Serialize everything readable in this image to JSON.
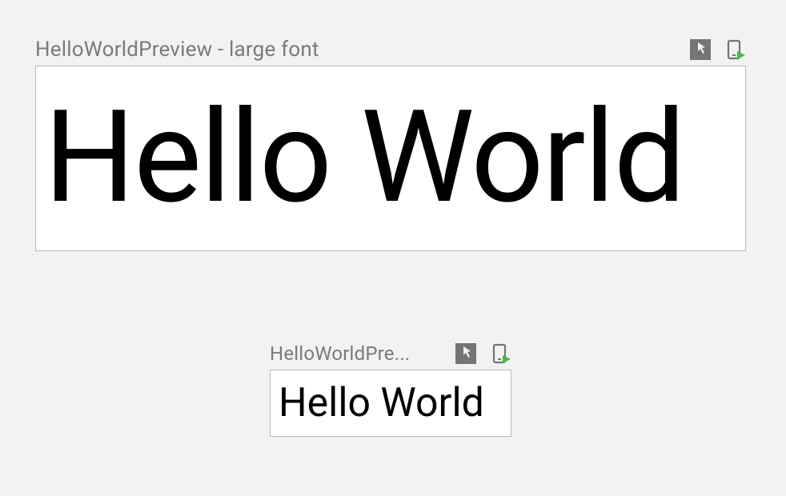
{
  "previews": [
    {
      "title": "HelloWorldPreview - large font",
      "text": "Hello World"
    },
    {
      "title": "HelloWorldPre...",
      "text": "Hello World"
    }
  ],
  "icons": {
    "interactive": "interactive-mode-icon",
    "deploy": "deploy-preview-icon"
  }
}
